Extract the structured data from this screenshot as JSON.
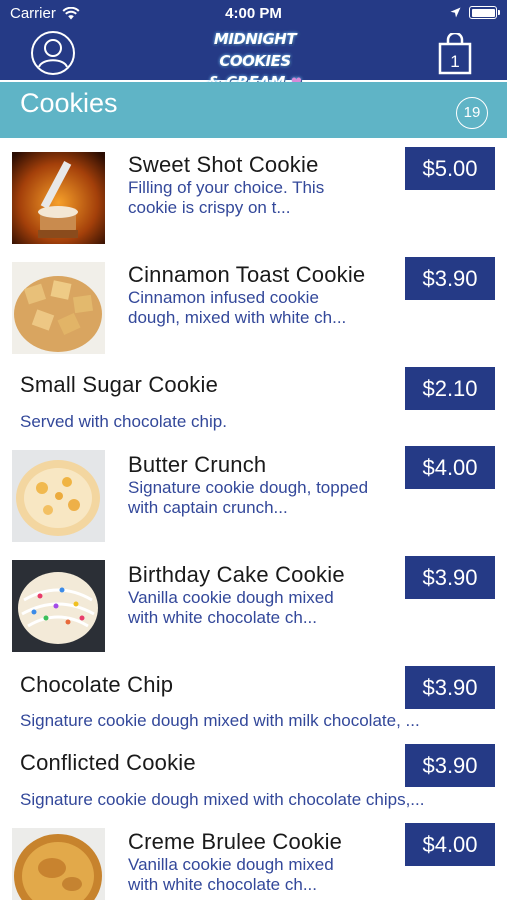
{
  "status_bar": {
    "carrier": "Carrier",
    "time": "4:00 PM"
  },
  "header": {
    "logo_line1": "MIDNIGHT COOKIES",
    "logo_line2": "& CREAM",
    "icons": {
      "profile": "user-circle-icon",
      "cart": "shopping-bag-icon"
    },
    "colors": {
      "navy": "#253a86",
      "teal": "#5fb4c6"
    }
  },
  "category": {
    "title": "Cookies",
    "count": "19"
  },
  "items": [
    {
      "name": "Sweet Shot Cookie",
      "desc_line1": "Filling of your choice. This",
      "desc_line2": "cookie is crispy on t...",
      "price": "$5.00"
    },
    {
      "name": "Cinnamon Toast Cookie",
      "desc_line1": "Cinnamon infused cookie",
      "desc_line2": "dough, mixed with white ch...",
      "price": "$3.90"
    },
    {
      "name": "Small Sugar Cookie",
      "desc": "Served with chocolate chip.",
      "price": "$2.10"
    },
    {
      "name": "Butter Crunch",
      "desc_line1": "Signature cookie dough, topped",
      "desc_line2": "with captain crunch...",
      "price": "$4.00"
    },
    {
      "name": "Birthday Cake Cookie",
      "desc_line1": "Vanilla cookie dough mixed",
      "desc_line2": "with white chocolate ch...",
      "price": "$3.90"
    },
    {
      "name": "Chocolate Chip",
      "desc": "Signature cookie dough mixed with milk chocolate, ...",
      "price": "$3.90"
    },
    {
      "name": "Conflicted Cookie",
      "desc": "Signature cookie dough mixed with chocolate chips,...",
      "price": "$3.90"
    },
    {
      "name": "Creme Brulee Cookie",
      "desc_line1": "Vanilla cookie dough mixed",
      "desc_line2": "with white chocolate ch...",
      "price": "$4.00"
    }
  ]
}
